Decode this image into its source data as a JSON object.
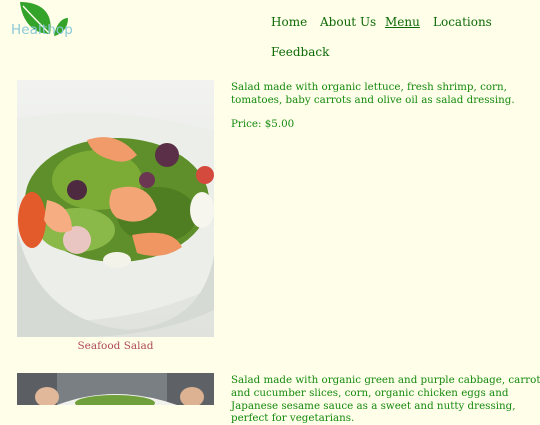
{
  "brand": {
    "logo_text": "Healthop",
    "colors": {
      "leaf": "#34a32a",
      "text": "#8dc9d8"
    }
  },
  "nav": {
    "items": [
      {
        "label": "Home",
        "active": false
      },
      {
        "label": "About Us",
        "active": false
      },
      {
        "label": "Menu",
        "active": true
      },
      {
        "label": "Locations",
        "active": false
      },
      {
        "label": "Feedback",
        "active": false
      }
    ]
  },
  "menu": [
    {
      "caption": "Seafood Salad",
      "description": "Salad made with organic lettuce, fresh shrimp, corn, tomatoes, baby carrots and olive oil as salad dressing.",
      "price": "Price: $5.00"
    },
    {
      "caption": "",
      "description": "Salad made with organic green and purple cabbage, carrot and cucumber slices, corn, organic chicken eggs and Japanese sesame sauce as a sweet and nutty dressing, perfect for vegetarians.",
      "price": ""
    }
  ]
}
